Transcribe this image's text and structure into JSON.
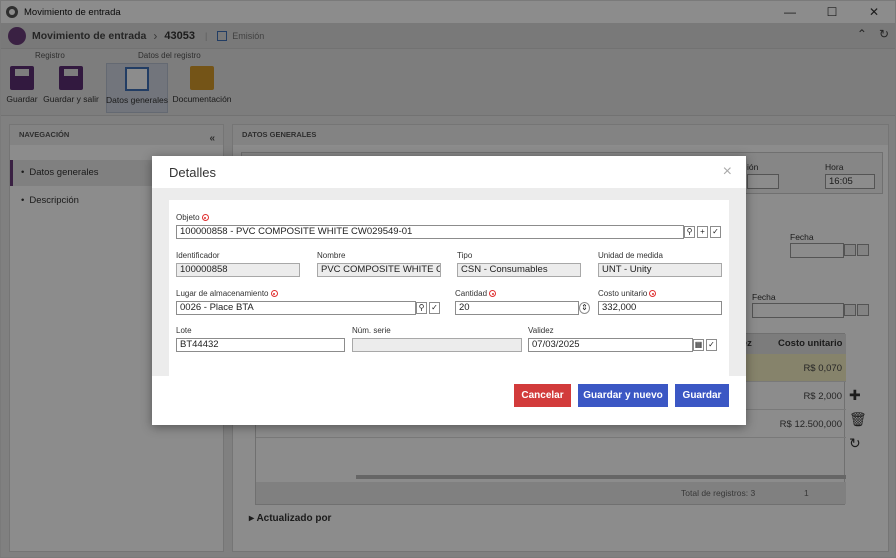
{
  "window": {
    "title": "Movimiento de entrada"
  },
  "header": {
    "module": "Movimiento de entrada",
    "record_id": "43053",
    "emission_label": "Emisión"
  },
  "ribbon": {
    "groups": [
      {
        "label": "Registro"
      },
      {
        "label": "Datos del registro"
      }
    ],
    "tools": [
      {
        "label": "Guardar"
      },
      {
        "label": "Guardar y salir"
      },
      {
        "label": "Datos generales"
      },
      {
        "label": "Documentación"
      }
    ]
  },
  "navigation": {
    "title": "NAVEGACIÓN",
    "items": [
      {
        "label": "Datos generales"
      },
      {
        "label": "Descripción"
      }
    ]
  },
  "content": {
    "title": "DATOS GENERALES",
    "labels": {
      "emission": "ión",
      "hour": "Hora",
      "date1": "Fecha",
      "date2": "Fecha"
    },
    "hour_value": "16:05",
    "table": {
      "header_partial": "dez",
      "header_cost": "Costo unitario",
      "rows": [
        {
          "cost": "R$ 0,070"
        },
        {
          "cost": "R$ 2,000"
        },
        {
          "cost": "R$ 12.500,000"
        }
      ],
      "total_label": "Total de registros: 3",
      "page": "1"
    },
    "updated_by": "Actualizado por"
  },
  "modal": {
    "title": "Detalles",
    "close_icon": "×",
    "fields": {
      "objeto": {
        "label": "Objeto",
        "value": "100000858 - PVC COMPOSITE WHITE CW029549-01"
      },
      "identificador": {
        "label": "Identificador",
        "value": "100000858"
      },
      "nombre": {
        "label": "Nombre",
        "value": "PVC COMPOSITE WHITE C'"
      },
      "tipo": {
        "label": "Tipo",
        "value": "CSN - Consumables"
      },
      "unidad": {
        "label": "Unidad de medida",
        "value": "UNT - Unity"
      },
      "lugar": {
        "label": "Lugar de almacenamiento",
        "value": "0026 - Place BTA"
      },
      "cantidad": {
        "label": "Cantidad",
        "value": "20"
      },
      "costo": {
        "label": "Costo unitario",
        "value": "332,000"
      },
      "lote": {
        "label": "Lote",
        "value": "BT44432"
      },
      "num_serie": {
        "label": "Núm. serie",
        "value": ""
      },
      "validez": {
        "label": "Validez",
        "value": "07/03/2025"
      }
    },
    "buttons": {
      "cancel": "Cancelar",
      "save_new": "Guardar y nuevo",
      "save": "Guardar"
    }
  }
}
